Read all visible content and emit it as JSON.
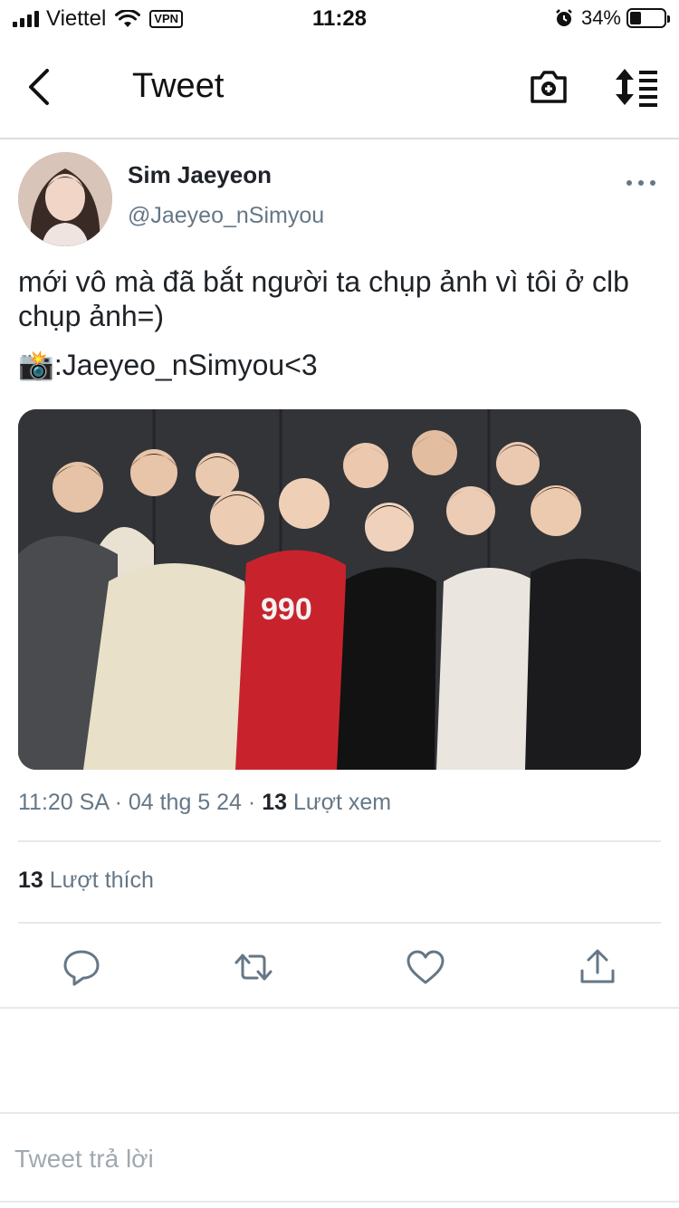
{
  "status_bar": {
    "carrier": "Viettel",
    "vpn": "VPN",
    "time": "11:28",
    "battery_pct": "34%",
    "battery_level": 0.34
  },
  "nav": {
    "title": "Tweet"
  },
  "tweet": {
    "display_name": "Sim Jaeyeon",
    "handle": "@Jaeyeo_nSimyou",
    "text": "mới vô mà đã bắt người ta chụp ảnh vì tôi ở clb chụp ảnh=)",
    "credit_emoji": "📸",
    "credit": ":Jaeyeo_nSimyou<3",
    "time": "11:20 SA",
    "date": "04 thg 5 24",
    "views_count": "13",
    "views_label": "Lượt xem",
    "likes_count": "13",
    "likes_label": "Lượt thích"
  },
  "reply": {
    "placeholder": "Tweet trả lời"
  },
  "colors": {
    "accent": "#1d9bf0",
    "icon": "#657786",
    "text": "#1f2328"
  }
}
